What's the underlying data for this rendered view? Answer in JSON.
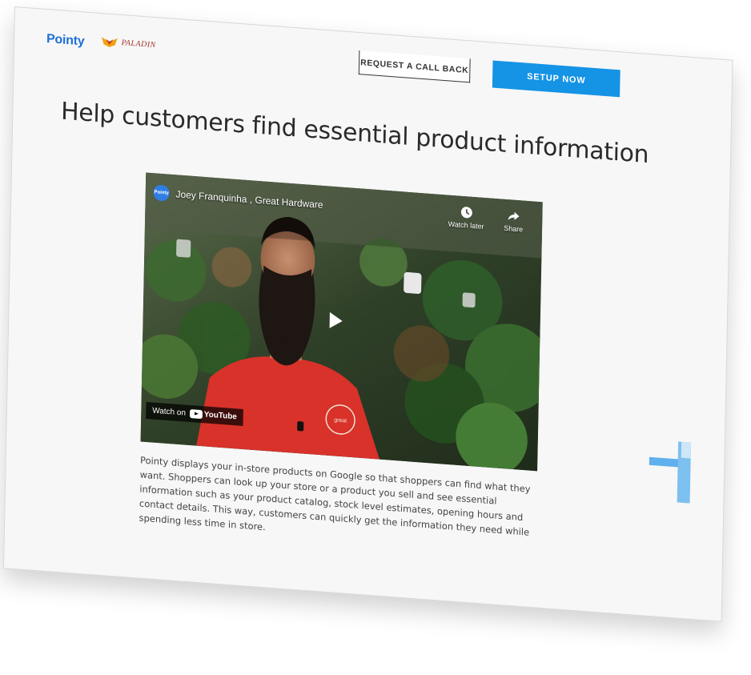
{
  "header": {
    "logo_pointy": "Pointy",
    "logo_paladin": "PALADIN",
    "request_callback_label": "REQUEST A CALL BACK",
    "setup_now_label": "SETUP NOW"
  },
  "main": {
    "headline": "Help customers find essential product information",
    "video": {
      "channel_avatar": "Pointy",
      "title": "Joey Franquinha , Great Hardware",
      "watch_later_label": "Watch later",
      "share_label": "Share",
      "watch_on_label": "Watch on",
      "youtube_label": "YouTube",
      "shirt_text": "great"
    },
    "description": "Pointy displays your in-store products on Google so that shoppers can find what they want. Shoppers can look up your store or a product you sell and see essential information such as your product catalog, stock level estimates, opening hours and contact details. This way, customers can quickly get the information they need while spending less time in store."
  },
  "colors": {
    "brand_blue": "#1f6fd8",
    "setup_button": "#1593e5",
    "headline_text": "#2a2a2a",
    "shirt_red": "#d8322a"
  },
  "icons": [
    "clock-icon",
    "share-arrow-icon",
    "play-icon",
    "youtube-logo-icon",
    "paladin-logo-icon"
  ]
}
